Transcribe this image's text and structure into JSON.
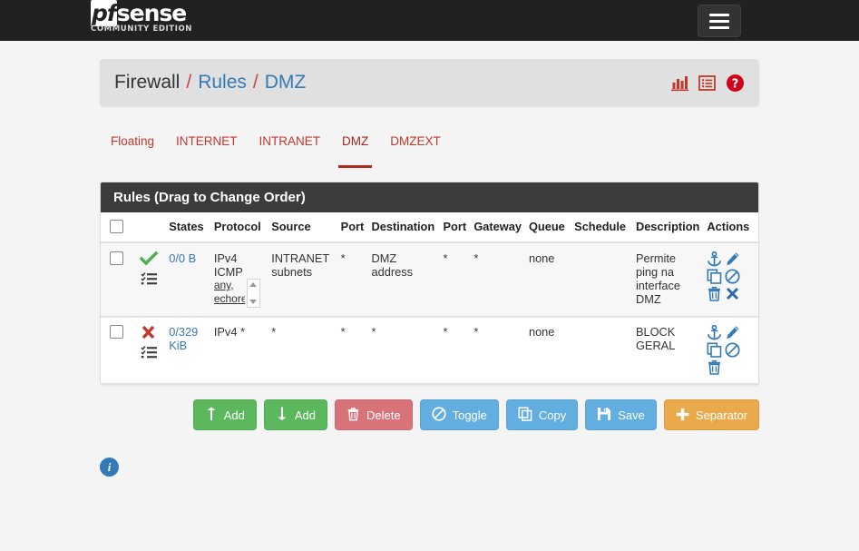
{
  "navbar": {
    "brand_name": "pfsense",
    "brand_prefix": "pf",
    "brand_rest": "sense",
    "brand_edition": "COMMUNITY EDITION",
    "menu_icon": "hamburger-icon"
  },
  "breadcrumb": {
    "root": "Firewall",
    "sep": "/",
    "section": "Rules",
    "page": "DMZ",
    "icons": [
      "chart-bar-icon",
      "list-table-icon",
      "help-circle-icon"
    ]
  },
  "tabs": [
    {
      "label": "Floating",
      "active": false
    },
    {
      "label": "INTERNET",
      "active": false
    },
    {
      "label": "INTRANET",
      "active": false
    },
    {
      "label": "DMZ",
      "active": true
    },
    {
      "label": "DMZEXT",
      "active": false
    }
  ],
  "panel": {
    "title": "Rules (Drag to Change Order)",
    "columns": [
      "",
      "",
      "States",
      "Protocol",
      "Source",
      "Port",
      "Destination",
      "Port",
      "Gateway",
      "Queue",
      "Schedule",
      "Description",
      "Actions"
    ]
  },
  "rules": [
    {
      "checked": false,
      "action_icon": "check-icon",
      "action_type": "pass",
      "states_icon": "tasks-icon",
      "states": "0/0 B",
      "protocol_main": "IPv4",
      "protocol_sub": "ICMP",
      "protocol_list": [
        "any,",
        "echorep"
      ],
      "source": "INTRANET subnets",
      "port_src": "*",
      "destination": "DMZ address",
      "port_dst": "*",
      "gateway": "*",
      "queue": "none",
      "schedule": "",
      "description": "Permite ping na interface DMZ",
      "actions": [
        "anchor-icon",
        "pencil-icon",
        "copy-icon",
        "ban-icon",
        "trash-icon",
        "times-icon"
      ],
      "hovered": true
    },
    {
      "checked": false,
      "action_icon": "times-red-icon",
      "action_type": "block",
      "states_icon": "tasks-icon",
      "states": "0/329 KiB",
      "protocol_main": "IPv4 *",
      "protocol_sub": "",
      "protocol_list": [],
      "source": "*",
      "port_src": "*",
      "destination": "*",
      "port_dst": "*",
      "gateway": "*",
      "queue": "none",
      "schedule": "",
      "description": "BLOCK GERAL",
      "actions": [
        "anchor-icon",
        "pencil-icon",
        "copy-icon",
        "ban-icon",
        "trash-icon"
      ],
      "hovered": false
    }
  ],
  "buttons": [
    {
      "label": "Add",
      "icon": "arrow-up-icon",
      "color": "green"
    },
    {
      "label": "Add",
      "icon": "arrow-down-icon",
      "color": "green"
    },
    {
      "label": "Delete",
      "icon": "trash-icon",
      "color": "red"
    },
    {
      "label": "Toggle",
      "icon": "ban-icon",
      "color": "blue"
    },
    {
      "label": "Copy",
      "icon": "copy-icon",
      "color": "blue"
    },
    {
      "label": "Save",
      "icon": "save-icon",
      "color": "blue"
    },
    {
      "label": "Separator",
      "icon": "plus-icon",
      "color": "orange"
    }
  ],
  "footer": {
    "info_icon": "info-circle-icon",
    "info_glyph": "i"
  },
  "colors": {
    "brand_dark": "#212121",
    "accent_red": "#c0392b",
    "link_blue": "#337ab7",
    "pass_green": "#4caf50",
    "block_red": "#c0392b",
    "icon_blue": "#337ab7",
    "panel_head": "#3c3c3c"
  }
}
